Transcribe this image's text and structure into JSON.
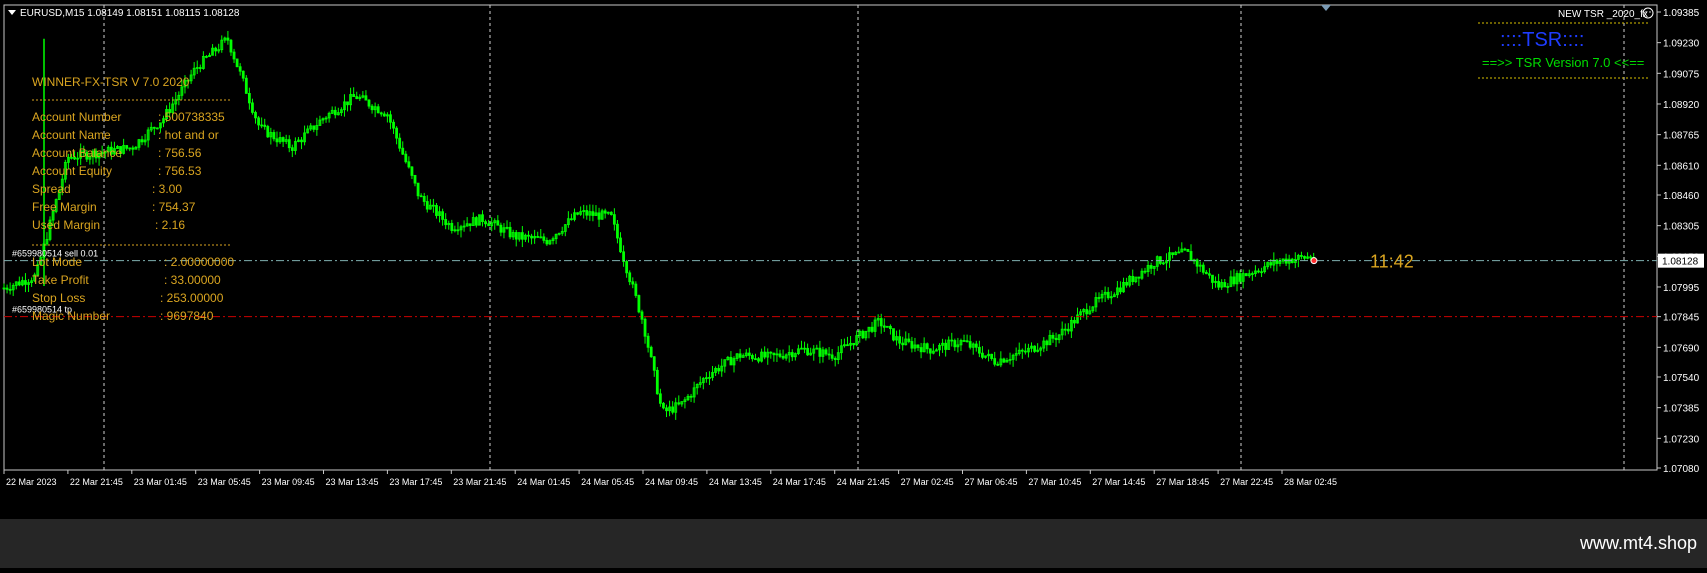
{
  "chart_header": {
    "symbol": "EURUSD,M15",
    "ohlc": "1.08149 1.08151 1.08115 1.08128"
  },
  "indicator_label": "NEW TSR _2020_fx",
  "tsr_box": {
    "title": "::::TSR::::",
    "subtitle": "==>> TSR Version 7.0 <<=="
  },
  "info_panel": {
    "title": "WINNER-FX-TSR V 7.0  2020",
    "rows": [
      {
        "label": "Account Number",
        "value": ": 500738335"
      },
      {
        "label": "Account Name",
        "value": ": hot and or"
      },
      {
        "label": "Account Balance",
        "value": ": 756.56"
      },
      {
        "label": "Account Equity",
        "value": ": 756.53"
      },
      {
        "label": "Spread",
        "value": ": 3.00"
      },
      {
        "label": "Free Margin",
        "value": ": 754.37"
      },
      {
        "label": "Used Margin",
        "value": ": 2.16"
      },
      {
        "label": "Lot Mode",
        "value": ": 2.00000000"
      },
      {
        "label": "Take Profit",
        "value": ": 33.00000"
      },
      {
        "label": "Stop Loss",
        "value": ": 253.00000"
      },
      {
        "label": "Magic Number",
        "value": ": 9697840"
      }
    ]
  },
  "order_labels": {
    "sell": "#659980514 sell 0.01",
    "tp": "#659980514 tp"
  },
  "timer": "11:42",
  "current_price": "1.08128",
  "price_axis": [
    "1.09385",
    "1.09230",
    "1.09075",
    "1.08920",
    "1.08765",
    "1.08610",
    "1.08460",
    "1.08305",
    "1.08150",
    "1.07995",
    "1.07845",
    "1.07690",
    "1.07540",
    "1.07385",
    "1.07230",
    "1.07080"
  ],
  "time_axis": [
    "22 Mar 2023",
    "22 Mar 21:45",
    "23 Mar 01:45",
    "23 Mar 05:45",
    "23 Mar 09:45",
    "23 Mar 13:45",
    "23 Mar 17:45",
    "23 Mar 21:45",
    "24 Mar 01:45",
    "24 Mar 05:45",
    "24 Mar 09:45",
    "24 Mar 13:45",
    "24 Mar 17:45",
    "24 Mar 21:45",
    "27 Mar 02:45",
    "27 Mar 06:45",
    "27 Mar 10:45",
    "27 Mar 14:45",
    "27 Mar 18:45",
    "27 Mar 22:45",
    "28 Mar 02:45"
  ],
  "watermark": "www.mt4.shop",
  "colors": {
    "background": "#000000",
    "candle": "#00ff00",
    "panel_text": "#DAA520",
    "tsr_title": "#1e3cff",
    "tsr_subtitle": "#00dd00",
    "tp_line": "#cc0000",
    "bid_line": "#7fb0b0"
  },
  "chart_data": {
    "type": "candlestick",
    "symbol": "EURUSD",
    "timeframe": "M15",
    "ylim": [
      1.0708,
      1.0939
    ],
    "x_labels": [
      "22 Mar 2023",
      "22 Mar 21:45",
      "23 Mar 01:45",
      "23 Mar 05:45",
      "23 Mar 09:45",
      "23 Mar 13:45",
      "23 Mar 17:45",
      "23 Mar 21:45",
      "24 Mar 01:45",
      "24 Mar 05:45",
      "24 Mar 09:45",
      "24 Mar 13:45",
      "24 Mar 17:45",
      "24 Mar 21:45",
      "27 Mar 02:45",
      "27 Mar 06:45",
      "27 Mar 10:45",
      "27 Mar 14:45",
      "27 Mar 18:45",
      "27 Mar 22:45",
      "28 Mar 02:45"
    ],
    "close_path": [
      [
        0,
        1.0799
      ],
      [
        0.5,
        1.0805
      ],
      [
        1,
        1.0865
      ],
      [
        2,
        1.087
      ],
      [
        2.5,
        1.0885
      ],
      [
        3,
        1.091
      ],
      [
        3.5,
        1.0925
      ],
      [
        4,
        1.088
      ],
      [
        4.5,
        1.087
      ],
      [
        5,
        1.0885
      ],
      [
        5.5,
        1.0896
      ],
      [
        6,
        1.0887
      ],
      [
        6.5,
        1.0845
      ],
      [
        7,
        1.083
      ],
      [
        7.5,
        1.0834
      ],
      [
        8,
        1.0825
      ],
      [
        8.5,
        1.0823
      ],
      [
        9,
        1.0837
      ],
      [
        9.5,
        1.0835
      ],
      [
        10,
        1.0782
      ],
      [
        10.3,
        1.0736
      ],
      [
        10.6,
        1.074
      ],
      [
        11,
        1.0755
      ],
      [
        11.5,
        1.0765
      ],
      [
        12,
        1.0764
      ],
      [
        12.5,
        1.0768
      ],
      [
        13,
        1.0765
      ],
      [
        13.4,
        1.0775
      ],
      [
        13.7,
        1.0782
      ],
      [
        14,
        1.0772
      ],
      [
        14.5,
        1.0768
      ],
      [
        15,
        1.0772
      ],
      [
        15.5,
        1.0762
      ],
      [
        16,
        1.0767
      ],
      [
        16.5,
        1.0775
      ],
      [
        17,
        1.079
      ],
      [
        17.5,
        1.08
      ],
      [
        18,
        1.0812
      ],
      [
        18.5,
        1.0817
      ],
      [
        19,
        1.08
      ],
      [
        19.5,
        1.0807
      ],
      [
        20,
        1.0813
      ],
      [
        20.5,
        1.0815
      ]
    ],
    "last_price": 1.08128,
    "take_profit_price": 1.08128,
    "tp_order_line_price": 1.07845
  }
}
